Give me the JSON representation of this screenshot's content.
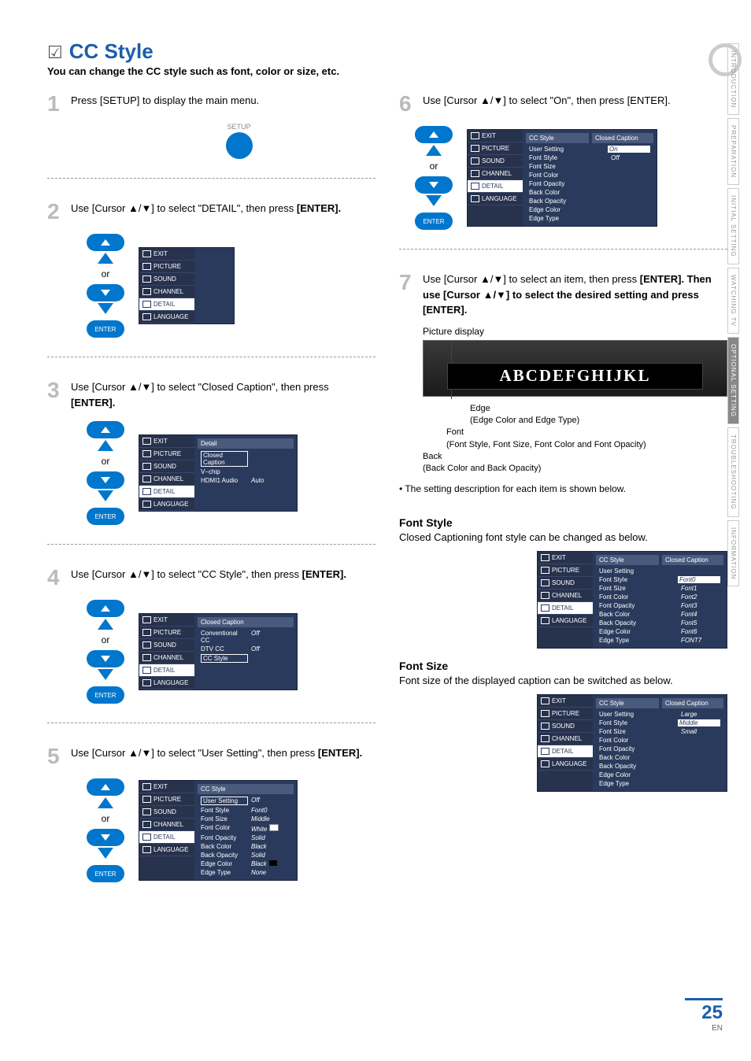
{
  "title": "CC Style",
  "subtitle": "You can change the CC style such as font, color or size, etc.",
  "sidebar": [
    "INTRODUCTION",
    "PREPARATION",
    "INITIAL SETTING",
    "WATCHING TV",
    "OPTIONAL SETTING",
    "TROUBLESHOOTING",
    "INFORMATION"
  ],
  "sidebar_active": 4,
  "steps": {
    "s1": "Press [SETUP] to display the main menu.",
    "s2a": "Use [Cursor ▲/▼] to select \"DETAIL\", then press ",
    "s2b": "[ENTER].",
    "s3a": "Use [Cursor ▲/▼] to select \"Closed Caption\", then press ",
    "s3b": "[ENTER].",
    "s4a": "Use [Cursor ▲/▼] to select \"CC Style\", then press ",
    "s4b": "[ENTER].",
    "s5a": "Use [Cursor ▲/▼] to select \"User Setting\", then press ",
    "s5b": "[ENTER].",
    "s6": "Use [Cursor ▲/▼] to select \"On\", then press [ENTER].",
    "s7a": "Use [Cursor ▲/▼] to select an item, then press ",
    "s7b": "[ENTER]. Then use [Cursor ▲/▼] to select the desired setting and press [ENTER]."
  },
  "nums": {
    "1": "1",
    "2": "2",
    "3": "3",
    "4": "4",
    "5": "5",
    "6": "6",
    "7": "7"
  },
  "setup_label": "SETUP",
  "or": "or",
  "enter": "ENTER",
  "osdSide": [
    "EXIT",
    "PICTURE",
    "SOUND",
    "CHANNEL",
    "DETAIL",
    "LANGUAGE"
  ],
  "osd3": {
    "title": "Detail",
    "rows": [
      [
        "Closed Caption",
        ""
      ],
      [
        "V−chip",
        ""
      ],
      [
        "HDMI1 Audio",
        "Auto"
      ]
    ]
  },
  "osd4": {
    "title": "Closed Caption",
    "rows": [
      [
        "Conventional CC",
        "Off"
      ],
      [
        "DTV CC",
        "Off"
      ],
      [
        "CC Style",
        ""
      ]
    ]
  },
  "osd5": {
    "title": "CC Style",
    "rows": [
      [
        "User Setting",
        "Off"
      ],
      [
        "Font Style",
        "Font0"
      ],
      [
        "Font Size",
        "Middle"
      ],
      [
        "Font Color",
        "White"
      ],
      [
        "Font Opacity",
        "Solid"
      ],
      [
        "Back Color",
        "Black"
      ],
      [
        "Back Opacity",
        "Solid"
      ],
      [
        "Edge Color",
        "Black"
      ],
      [
        "Edge Type",
        "None"
      ]
    ]
  },
  "osd6": {
    "title": "CC Style",
    "rtitle": "Closed Caption",
    "rows": [
      [
        "User Setting",
        "On"
      ],
      [
        "Font Style",
        "Off"
      ],
      [
        "Font Size",
        ""
      ],
      [
        "Font Color",
        ""
      ],
      [
        "Font Opacity",
        ""
      ],
      [
        "Back Color",
        ""
      ],
      [
        "Back Opacity",
        ""
      ],
      [
        "Edge Color",
        ""
      ],
      [
        "Edge Type",
        ""
      ]
    ]
  },
  "pic_label": "Picture display",
  "alphabet": "ABCDEFGHIJKL",
  "labels": {
    "edge": "Edge",
    "edge_sub": "(Edge Color and Edge Type)",
    "font": "Font",
    "font_sub": "(Font Style, Font Size, Font Color and Font Opacity)",
    "back": "Back",
    "back_sub": "(Back Color and Back Opacity)"
  },
  "note": "The setting description for each item is shown below.",
  "fs_title": "Font Style",
  "fs_text": "Closed Captioning font style can be changed as below.",
  "fs_osd": {
    "title": "CC Style",
    "rtitle": "Closed Caption",
    "rows": [
      [
        "User Setting",
        ""
      ],
      [
        "Font Style",
        "Font0"
      ],
      [
        "Font Size",
        "Font1"
      ],
      [
        "Font Color",
        "Font2"
      ],
      [
        "Font Opacity",
        "Font3"
      ],
      [
        "Back Color",
        "Font4"
      ],
      [
        "Back Opacity",
        "Font5"
      ],
      [
        "Edge Color",
        "Font6"
      ],
      [
        "Edge Type",
        "FONT7"
      ]
    ]
  },
  "fz_title": "Font Size",
  "fz_text": "Font size of the displayed caption can be switched as below.",
  "fz_osd": {
    "title": "CC Style",
    "rtitle": "Closed Caption",
    "rows": [
      [
        "User Setting",
        "Large"
      ],
      [
        "Font Style",
        "Middle"
      ],
      [
        "Font Size",
        "Small"
      ],
      [
        "Font Color",
        ""
      ],
      [
        "Font Opacity",
        ""
      ],
      [
        "Back Color",
        ""
      ],
      [
        "Back Opacity",
        ""
      ],
      [
        "Edge Color",
        ""
      ],
      [
        "Edge Type",
        ""
      ]
    ]
  },
  "page_num": "25",
  "page_lang": "EN"
}
